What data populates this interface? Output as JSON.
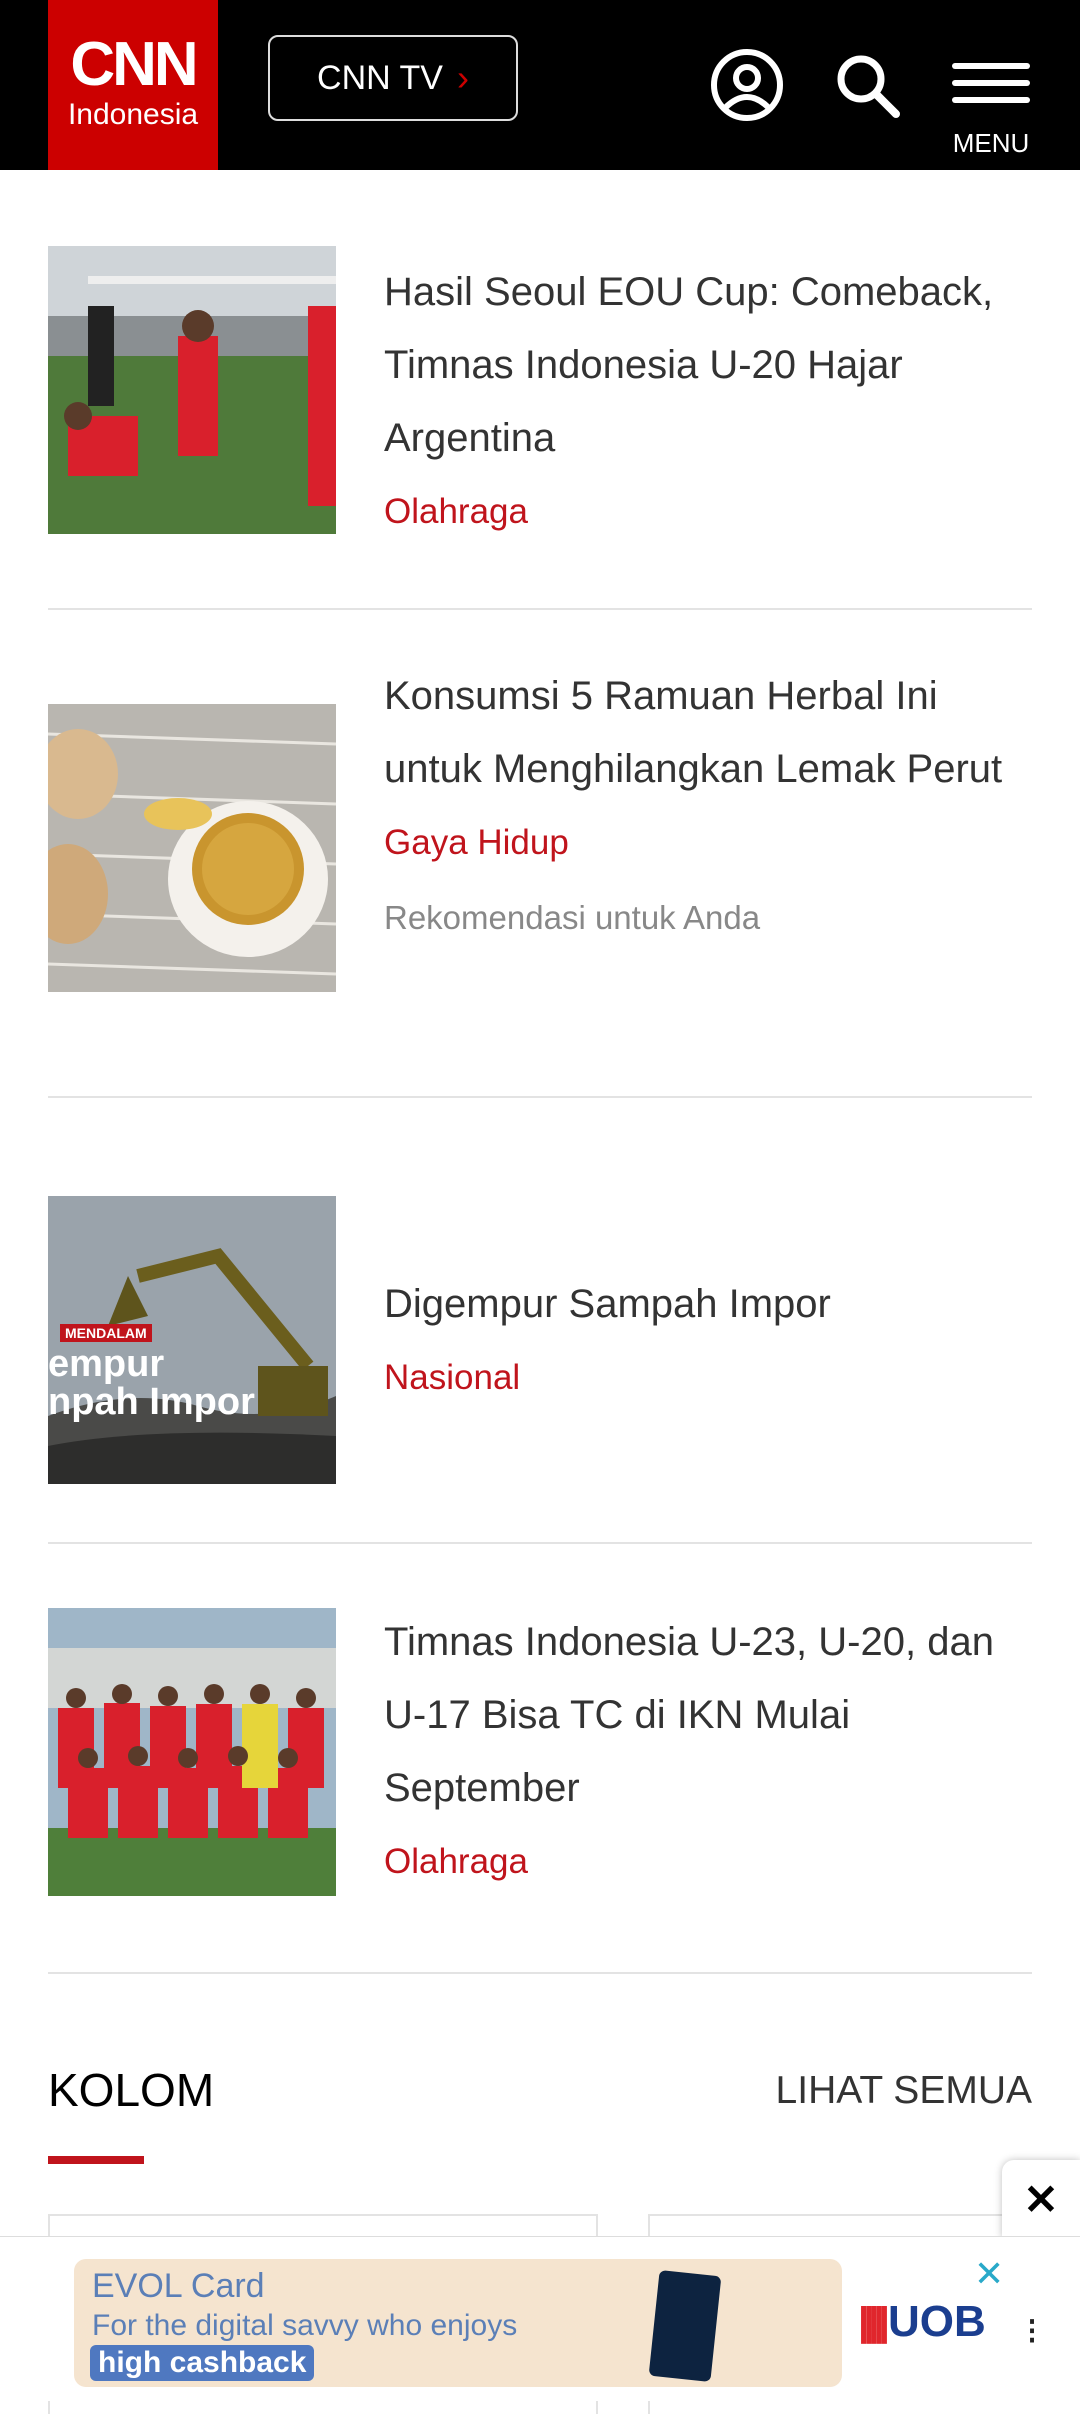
{
  "header": {
    "logo_main": "CNN",
    "logo_sub": "Indonesia",
    "tv_label": "CNN TV",
    "tv_chevron": "›",
    "menu_label": "MENU",
    "icons": [
      "user-icon",
      "search-icon",
      "hamburger-menu-icon"
    ]
  },
  "articles": [
    {
      "title": "Hasil Seoul EOU Cup: Comeback, Timnas Indonesia U-20 Hajar Argentina",
      "category": "Olahraga"
    },
    {
      "title": "Konsumsi 5 Ramuan Herbal Ini untuk Menghilangkan Lemak Perut",
      "category": "Gaya Hidup",
      "note": "Rekomendasi untuk Anda"
    },
    {
      "title": "Digempur Sampah Impor",
      "category": "Nasional",
      "thumb_tag": "MENDALAM",
      "thumb_text_1": "empur",
      "thumb_text_2": "npah Impor"
    },
    {
      "title": "Timnas Indonesia U-23, U-20, dan U-17 Bisa TC di IKN Mulai September",
      "category": "Olahraga"
    }
  ],
  "kolom": {
    "title": "KOLOM",
    "see_all": "LIHAT SEMUA"
  },
  "ad": {
    "headline": "EVOL Card",
    "subline": "For the digital savvy who enjoys",
    "highlight": "high cashback",
    "brand": "UOB",
    "brand_mark": "|||||"
  },
  "colors": {
    "brand_red": "#cc0000",
    "category_red": "#c0141c",
    "header_bg": "#000000"
  }
}
